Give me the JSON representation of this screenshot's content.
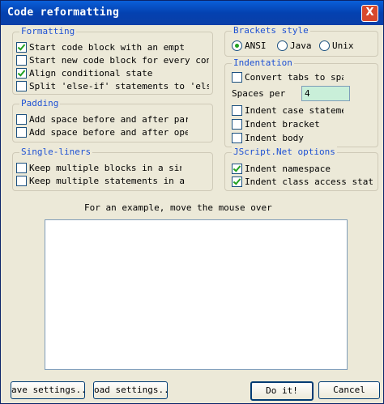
{
  "window": {
    "title": "Code reformatting",
    "close_glyph": "X"
  },
  "formatting": {
    "legend": "Formatting",
    "items": [
      {
        "label": "Start code block with an empt",
        "checked": true
      },
      {
        "label": "Start new code block for every conc",
        "checked": false
      },
      {
        "label": "Align conditional state",
        "checked": true
      },
      {
        "label": "Split 'else-if' statements to 'else'",
        "checked": false
      }
    ]
  },
  "padding": {
    "legend": "Padding",
    "items": [
      {
        "label": "Add space before and after parent",
        "checked": false
      },
      {
        "label": "Add space before and after oper",
        "checked": false
      }
    ]
  },
  "singleliners": {
    "legend": "Single-liners",
    "items": [
      {
        "label": "Keep multiple blocks in a sin",
        "checked": false
      },
      {
        "label": "Keep multiple statements in a sin",
        "checked": false
      }
    ]
  },
  "brackets": {
    "legend": "Brackets style",
    "options": [
      {
        "label": "ANSI",
        "selected": true
      },
      {
        "label": "Java",
        "selected": false
      },
      {
        "label": "Unix",
        "selected": false
      }
    ]
  },
  "indentation": {
    "legend": "Indentation",
    "convert_tabs": {
      "label": "Convert tabs to spac",
      "checked": false
    },
    "spaces_label": "Spaces per",
    "spaces_value": "4",
    "items": [
      {
        "label": "Indent case statemer",
        "checked": false
      },
      {
        "label": "Indent bracket",
        "checked": false
      },
      {
        "label": "Indent body",
        "checked": false
      }
    ]
  },
  "jscript": {
    "legend": "JScript.Net options",
    "items": [
      {
        "label": "Indent namespace",
        "checked": true
      },
      {
        "label": "Indent class access statem",
        "checked": true
      }
    ]
  },
  "preview": {
    "hint": "For an example, move the mouse over"
  },
  "buttons": {
    "save": "ave settings...",
    "load": "oad settings...",
    "doit": "Do it!",
    "cancel": "Cancel"
  },
  "colors": {
    "title_bar": "#0a5fd8",
    "legend_text": "#1f52d4",
    "check_mark": "#21a121",
    "spaces_box": "#c9efd9"
  }
}
